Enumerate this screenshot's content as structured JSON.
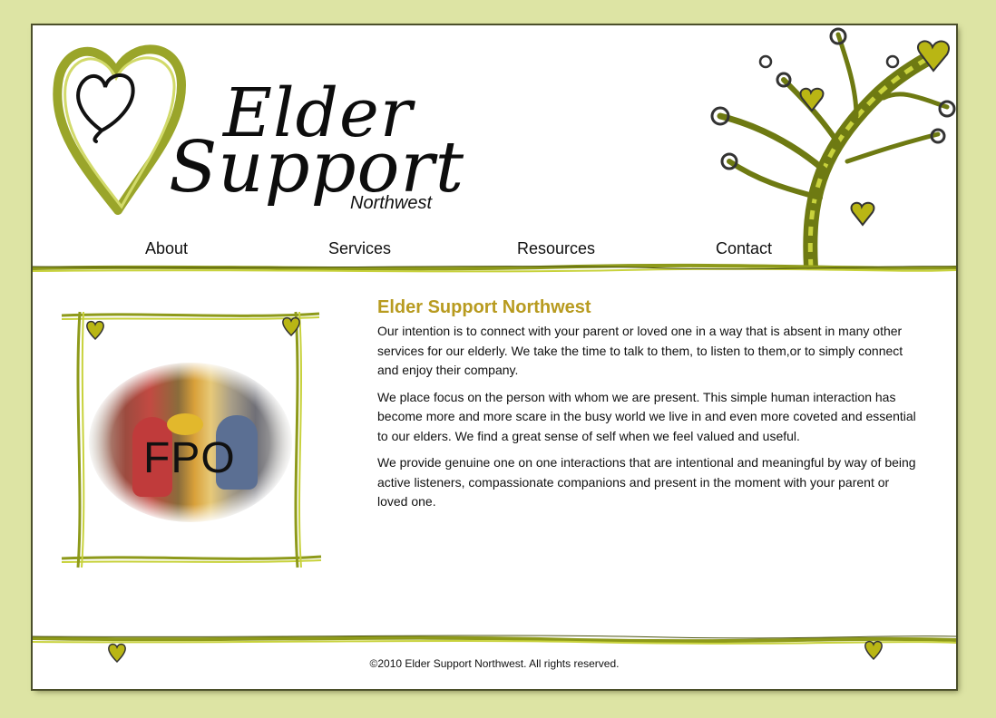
{
  "logo": {
    "line1": "Elder",
    "line2": "Support",
    "sub": "Northwest"
  },
  "nav": {
    "items": [
      {
        "label": "About"
      },
      {
        "label": "Services"
      },
      {
        "label": "Resources"
      },
      {
        "label": "Contact"
      }
    ]
  },
  "photo": {
    "placeholder": "FPO"
  },
  "main": {
    "heading": "Elder Support Northwest",
    "paragraphs": [
      "Our intention is to connect with your parent or loved one in a way that is absent in many other services for our elderly. We take the time to talk to them, to listen to them,or to simply connect and enjoy their company.",
      "We place focus on the person with whom we are present. This simple human interaction has become more and more scare in the busy world we live in and even more coveted and essential to our elders. We find a great sense of self when we feel valued and useful.",
      "We provide genuine one on one interactions that are intentional and meaningful by way of being active listeners, compassionate companions and present in the moment with your parent or loved one."
    ]
  },
  "footer": {
    "copyright": "©2010 Elder Support Northwest. All rights reserved."
  },
  "colors": {
    "background": "#dde4a4",
    "accent": "#b89b20",
    "olive": "#8e9a1a"
  },
  "icons": [
    "heart-logo-icon",
    "tree-icon",
    "heart-icon"
  ]
}
